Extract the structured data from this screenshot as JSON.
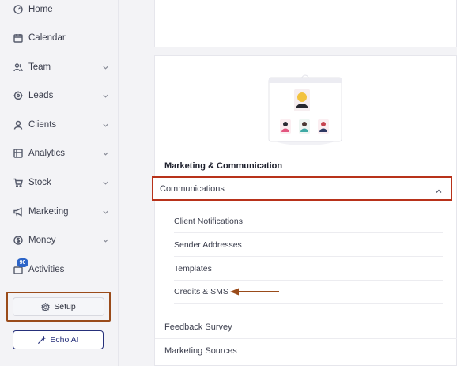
{
  "sidebar": {
    "items": [
      {
        "label": "Home",
        "icon": "dashboard-icon",
        "has_chevron": false
      },
      {
        "label": "Calendar",
        "icon": "calendar-icon",
        "has_chevron": false
      },
      {
        "label": "Team",
        "icon": "team-icon",
        "has_chevron": true
      },
      {
        "label": "Leads",
        "icon": "leads-icon",
        "has_chevron": true
      },
      {
        "label": "Clients",
        "icon": "user-icon",
        "has_chevron": true
      },
      {
        "label": "Analytics",
        "icon": "analytics-icon",
        "has_chevron": true
      },
      {
        "label": "Stock",
        "icon": "cart-icon",
        "has_chevron": true
      },
      {
        "label": "Marketing",
        "icon": "megaphone-icon",
        "has_chevron": true
      },
      {
        "label": "Money",
        "icon": "dollar-icon",
        "has_chevron": true
      },
      {
        "label": "Activities",
        "icon": "activities-icon",
        "has_chevron": false
      }
    ],
    "activities_badge": "90",
    "setup_label": "Setup",
    "echo_label": "Echo AI"
  },
  "main": {
    "section_title": "Marketing & Communication",
    "communications_label": "Communications",
    "sub_items": [
      "Client Notifications",
      "Sender Addresses",
      "Templates",
      "Credits & SMS"
    ],
    "rows": [
      "Feedback Survey",
      "Marketing Sources"
    ]
  },
  "colors": {
    "highlight_border": "#b8321a",
    "arrow": "#9a4b1a",
    "echo_accent": "#26307a",
    "badge": "#2c64c8"
  }
}
